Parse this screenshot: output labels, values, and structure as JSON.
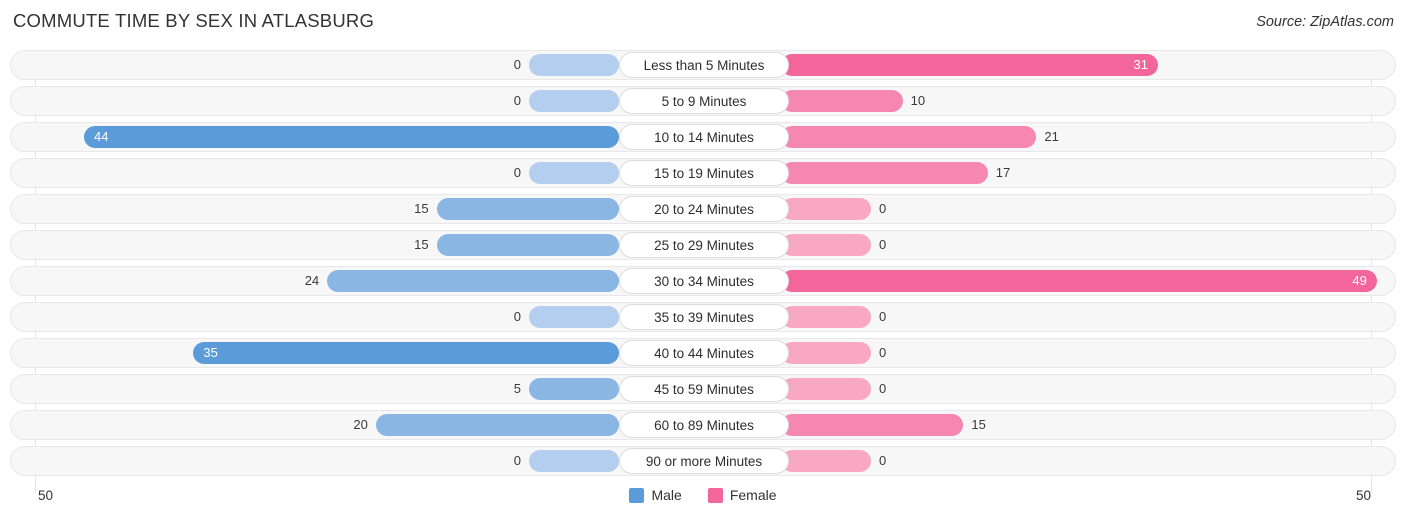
{
  "header": {
    "title": "COMMUTE TIME BY SEX IN ATLASBURG",
    "source": "Source: ZipAtlas.com"
  },
  "axis": {
    "left_max": "50",
    "right_max": "50"
  },
  "legend": [
    {
      "label": "Male",
      "color": "#5b9bd9"
    },
    {
      "label": "Female",
      "color": "#f2669c"
    }
  ],
  "colors": {
    "male_strong": "#5b9bd9",
    "male_mid": "#8ab6e3",
    "male_light": "#b3ceee",
    "female_strong": "#f2669c",
    "female_mid": "#f587b0",
    "female_light": "#f9a8c4",
    "track": "#f7f7f7",
    "grid": "#e3e3e3"
  },
  "chart_data": {
    "type": "bar",
    "title": "COMMUTE TIME BY SEX IN ATLASBURG",
    "subtitle": "",
    "xlabel": "",
    "ylabel": "",
    "orientation": "horizontal-diverging",
    "xlim": [
      50,
      50
    ],
    "grid": true,
    "legend_position": "bottom-center",
    "categories": [
      "Less than 5 Minutes",
      "5 to 9 Minutes",
      "10 to 14 Minutes",
      "15 to 19 Minutes",
      "20 to 24 Minutes",
      "25 to 29 Minutes",
      "30 to 34 Minutes",
      "35 to 39 Minutes",
      "40 to 44 Minutes",
      "45 to 59 Minutes",
      "60 to 89 Minutes",
      "90 or more Minutes"
    ],
    "series": [
      {
        "name": "Male",
        "direction": "left",
        "values": [
          0,
          0,
          44,
          0,
          15,
          15,
          24,
          0,
          35,
          5,
          20,
          0
        ]
      },
      {
        "name": "Female",
        "direction": "right",
        "values": [
          31,
          10,
          21,
          17,
          0,
          0,
          49,
          0,
          0,
          0,
          15,
          0
        ]
      }
    ]
  }
}
